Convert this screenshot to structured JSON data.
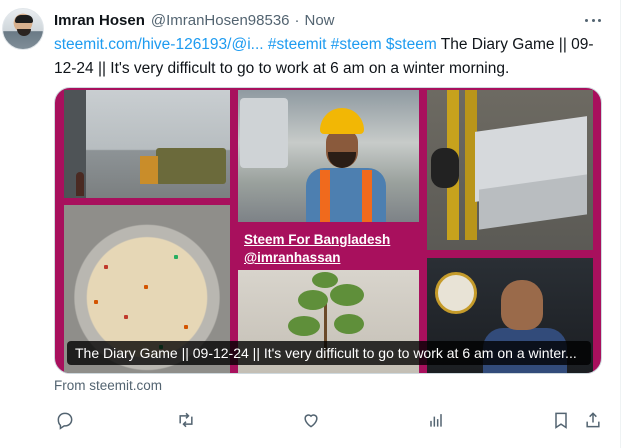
{
  "tweet": {
    "author_name": "Imran Hosen",
    "author_handle": "@ImranHosen98536",
    "separator": "·",
    "timestamp": "Now",
    "link_text": "steemit.com/hive-126193/@i...",
    "hashtags": "#steemit #steem $steem",
    "body_text": "The Diary Game || 09-12-24 || It's very difficult to go to work at 6 am on a winter morning.",
    "media": {
      "caption_line1": "Steem For Bangladesh",
      "caption_line2": "@imranhassan",
      "card_title": "The Diary Game || 09-12-24 || It's very difficult to go to work at 6 am on a winter..."
    },
    "source": "From steemit.com"
  },
  "actions": [
    {
      "icon": "reply-icon"
    },
    {
      "icon": "retweet-icon"
    },
    {
      "icon": "like-icon"
    },
    {
      "icon": "views-icon"
    },
    {
      "icon": "bookmark-icon"
    },
    {
      "icon": "share-icon"
    }
  ],
  "colors": {
    "link": "#1d9bf0",
    "media_background": "#a8105d",
    "secondary_text": "#536471"
  }
}
